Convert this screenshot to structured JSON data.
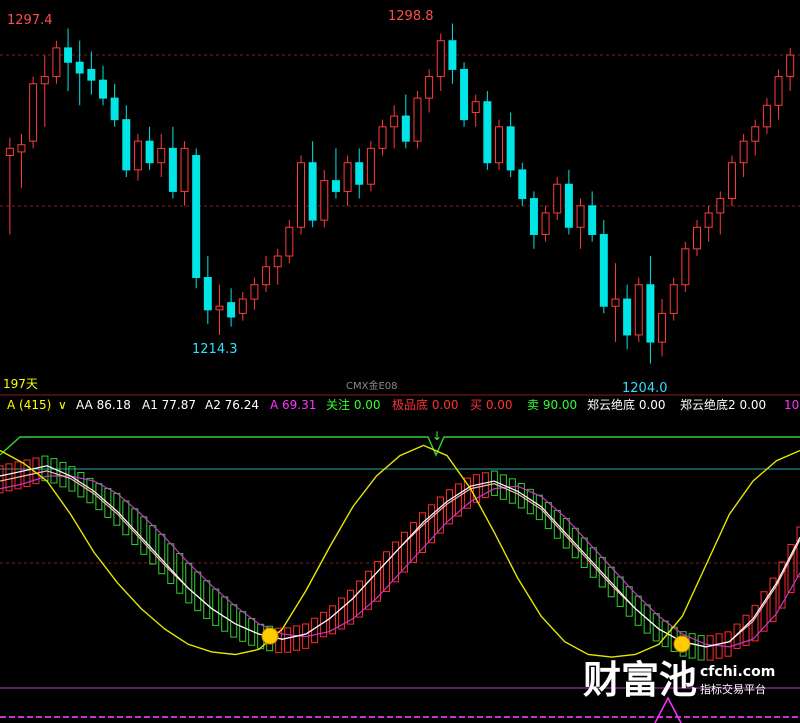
{
  "chart_data": [
    {
      "type": "candlestick",
      "name": "price",
      "symbol_label": "CMX金E08",
      "period_label": "197天",
      "annotations": {
        "high1": "1297.4",
        "low1": "1214.3",
        "high2": "1298.8",
        "low2": "1204.0"
      },
      "annotation_values": {
        "high1": 1297.4,
        "low1": 1214.3,
        "high2": 1298.8,
        "low2": 1204.0
      },
      "ohlc": [
        [
          1262,
          1267,
          1240,
          1264
        ],
        [
          1263,
          1268,
          1253,
          1265
        ],
        [
          1266,
          1284,
          1264,
          1282
        ],
        [
          1282,
          1290,
          1270,
          1284
        ],
        [
          1284,
          1294,
          1282,
          1292
        ],
        [
          1292,
          1297.4,
          1280,
          1288
        ],
        [
          1288,
          1294,
          1276,
          1285
        ],
        [
          1286,
          1291,
          1279,
          1283
        ],
        [
          1283,
          1287,
          1276,
          1278
        ],
        [
          1278,
          1282,
          1270,
          1272
        ],
        [
          1272,
          1276,
          1256,
          1258
        ],
        [
          1258,
          1268,
          1255,
          1266
        ],
        [
          1266,
          1270,
          1258,
          1260
        ],
        [
          1260,
          1268,
          1256,
          1264
        ],
        [
          1264,
          1270,
          1250,
          1252
        ],
        [
          1252,
          1266,
          1248,
          1264
        ],
        [
          1262,
          1264,
          1225,
          1228
        ],
        [
          1228,
          1234,
          1215,
          1219
        ],
        [
          1219,
          1226,
          1212,
          1220
        ],
        [
          1221,
          1225,
          1214.3,
          1217
        ],
        [
          1218,
          1224,
          1216,
          1222
        ],
        [
          1222,
          1228,
          1219,
          1226
        ],
        [
          1226,
          1234,
          1224,
          1231
        ],
        [
          1231,
          1236,
          1226,
          1234
        ],
        [
          1234,
          1244,
          1232,
          1242
        ],
        [
          1242,
          1262,
          1240,
          1260
        ],
        [
          1260,
          1266,
          1242,
          1244
        ],
        [
          1244,
          1258,
          1242,
          1255
        ],
        [
          1255,
          1264,
          1250,
          1252
        ],
        [
          1252,
          1262,
          1248,
          1260
        ],
        [
          1260,
          1264,
          1250,
          1254
        ],
        [
          1254,
          1266,
          1252,
          1264
        ],
        [
          1264,
          1272,
          1262,
          1270
        ],
        [
          1270,
          1276,
          1264,
          1273
        ],
        [
          1273,
          1279,
          1264,
          1266
        ],
        [
          1266,
          1280,
          1264,
          1278
        ],
        [
          1278,
          1286,
          1274,
          1284
        ],
        [
          1284,
          1296,
          1280,
          1294
        ],
        [
          1294,
          1298.8,
          1282,
          1286
        ],
        [
          1286,
          1288,
          1270,
          1272
        ],
        [
          1274,
          1279,
          1270,
          1277
        ],
        [
          1277,
          1280,
          1258,
          1260
        ],
        [
          1260,
          1272,
          1258,
          1270
        ],
        [
          1270,
          1274,
          1256,
          1258
        ],
        [
          1258,
          1260,
          1248,
          1250
        ],
        [
          1250,
          1252,
          1236,
          1240
        ],
        [
          1240,
          1248,
          1238,
          1246
        ],
        [
          1246,
          1256,
          1244,
          1254
        ],
        [
          1254,
          1258,
          1240,
          1242
        ],
        [
          1242,
          1250,
          1236,
          1248
        ],
        [
          1248,
          1252,
          1238,
          1240
        ],
        [
          1240,
          1244,
          1218,
          1220
        ],
        [
          1220,
          1232,
          1210,
          1222
        ],
        [
          1222,
          1226,
          1208,
          1212
        ],
        [
          1212,
          1228,
          1210,
          1226
        ],
        [
          1226,
          1234,
          1204.0,
          1210
        ],
        [
          1210,
          1222,
          1206,
          1218
        ],
        [
          1218,
          1228,
          1216,
          1226
        ],
        [
          1226,
          1238,
          1224,
          1236
        ],
        [
          1236,
          1244,
          1234,
          1242
        ],
        [
          1242,
          1248,
          1238,
          1246
        ],
        [
          1246,
          1252,
          1240,
          1250
        ],
        [
          1250,
          1262,
          1248,
          1260
        ],
        [
          1260,
          1268,
          1256,
          1266
        ],
        [
          1266,
          1272,
          1262,
          1270
        ],
        [
          1270,
          1278,
          1268,
          1276
        ],
        [
          1276,
          1286,
          1272,
          1284
        ],
        [
          1284,
          1292,
          1280,
          1290
        ]
      ],
      "y_range": [
        1200,
        1302
      ]
    },
    {
      "type": "indicator",
      "name": "oscillator",
      "legend": [
        {
          "text": "A (415)",
          "color": "#ffff00"
        },
        {
          "text": "∨",
          "color": "#ffff00"
        },
        {
          "text": "AA 86.18",
          "color": "#ffffff"
        },
        {
          "text": "A1 77.87",
          "color": "#ffffff"
        },
        {
          "text": "A2 76.24",
          "color": "#ffffff"
        },
        {
          "text": "A 69.31",
          "color": "#ff33ff"
        },
        {
          "text": "关注 0.00",
          "color": "#33ff33"
        },
        {
          "text": "极品底 0.00",
          "color": "#ff3333"
        },
        {
          "text": "买 0.00",
          "color": "#ff3333"
        },
        {
          "text": "卖 90.00",
          "color": "#33ff33"
        },
        {
          "text": "郑云绝底 0.00",
          "color": "#ffffff"
        },
        {
          "text": "郑云绝底2 0.00",
          "color": "#ffffff"
        },
        {
          "text": "10",
          "color": "#ff33ff"
        }
      ],
      "y_range": [
        0,
        100
      ],
      "reference_lines": [
        92,
        80,
        50,
        10
      ],
      "series": {
        "yellow": [
          90,
          85,
          78,
          65,
          50,
          38,
          28,
          20,
          14,
          11,
          10,
          12,
          20,
          35,
          52,
          68,
          80,
          88,
          92,
          88,
          75,
          58,
          40,
          25,
          15,
          10,
          9,
          10,
          14,
          25,
          45,
          65,
          78,
          86,
          90
        ],
        "white": [
          80,
          82,
          84,
          80,
          74,
          66,
          56,
          46,
          36,
          28,
          22,
          18,
          16,
          18,
          24,
          32,
          42,
          52,
          62,
          70,
          76,
          78,
          74,
          68,
          58,
          48,
          38,
          28,
          20,
          15,
          13,
          15,
          24,
          38,
          56
        ],
        "pink": [
          78,
          80,
          82,
          79,
          73,
          65,
          55,
          45,
          36,
          28,
          22,
          18,
          16,
          18,
          24,
          32,
          42,
          52,
          61,
          69,
          75,
          77,
          73,
          67,
          57,
          47,
          37,
          28,
          20,
          15,
          13,
          15,
          23,
          37,
          55
        ],
        "magenta": [
          75,
          77,
          80,
          80,
          78,
          73,
          65,
          56,
          46,
          37,
          29,
          22,
          18,
          17,
          19,
          24,
          32,
          42,
          52,
          62,
          70,
          75,
          76,
          72,
          64,
          54,
          44,
          34,
          25,
          18,
          14,
          13,
          16,
          26,
          42
        ]
      },
      "arrow_marks": [
        "↓"
      ]
    }
  ],
  "watermark": {
    "brand": "财富池",
    "domain": "cfchi.com",
    "tagline": "指标交易平台"
  }
}
